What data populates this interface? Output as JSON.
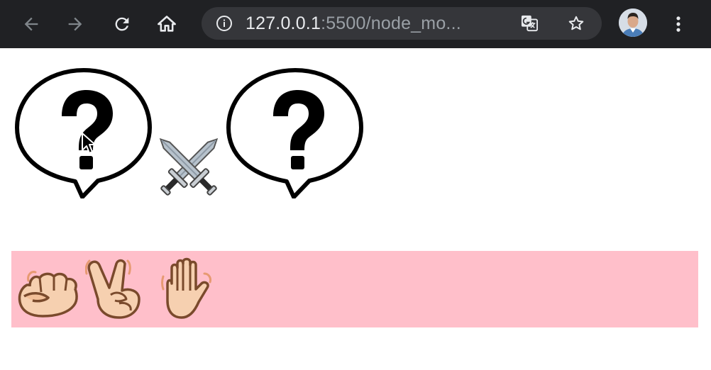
{
  "browser": {
    "url_host": "127.0.0.1",
    "url_rest": ":5500/node_mo...",
    "icons": [
      "back-arrow-icon",
      "forward-arrow-icon",
      "reload-icon",
      "home-icon",
      "info-icon",
      "translate-icon",
      "star-icon",
      "avatar",
      "more-vert-icon"
    ],
    "colors": {
      "toolbar": "#202124",
      "omnibox": "#35363a",
      "icon": "#e8eaed",
      "icon_disabled": "#80868b"
    }
  },
  "game": {
    "player_choice_icon": "question-bubble-icon",
    "versus_icon": "crossed-swords-icon",
    "computer_choice_icon": "question-bubble-icon",
    "hands": [
      "rock-fist-icon",
      "scissors-hand-icon",
      "paper-hand-icon"
    ],
    "colors": {
      "hand_bar": "#ffbfca"
    }
  }
}
